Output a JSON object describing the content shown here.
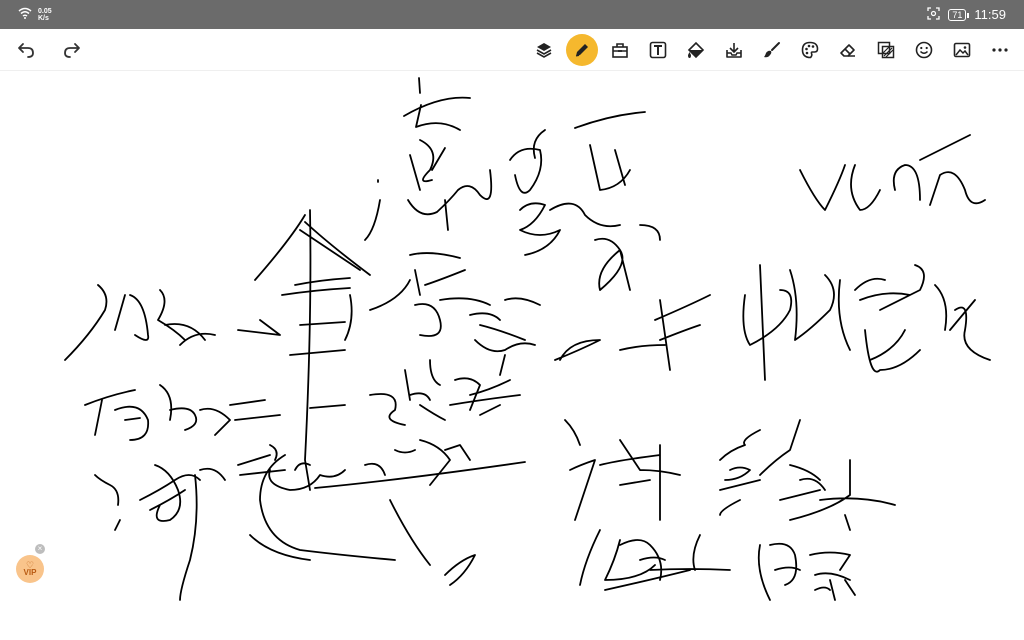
{
  "status_bar": {
    "net_speed_value": "0.05",
    "net_speed_unit": "K/s",
    "battery": "71",
    "time": "11:59"
  },
  "toolbar": {
    "left_tools": [
      "undo-icon",
      "redo-icon"
    ],
    "right_tools": [
      "layers-icon",
      "pen-icon",
      "toolbox-icon",
      "text-icon",
      "fill-bucket-icon",
      "import-icon",
      "brush-icon",
      "palette-icon",
      "eraser-icon",
      "layer-blend-icon",
      "emoji-icon",
      "image-icon",
      "more-icon"
    ],
    "active_tool": "pen-icon",
    "active_color": "#f5b82e"
  },
  "vip_badge": {
    "label": "VIP",
    "color": "#f9c48b"
  }
}
